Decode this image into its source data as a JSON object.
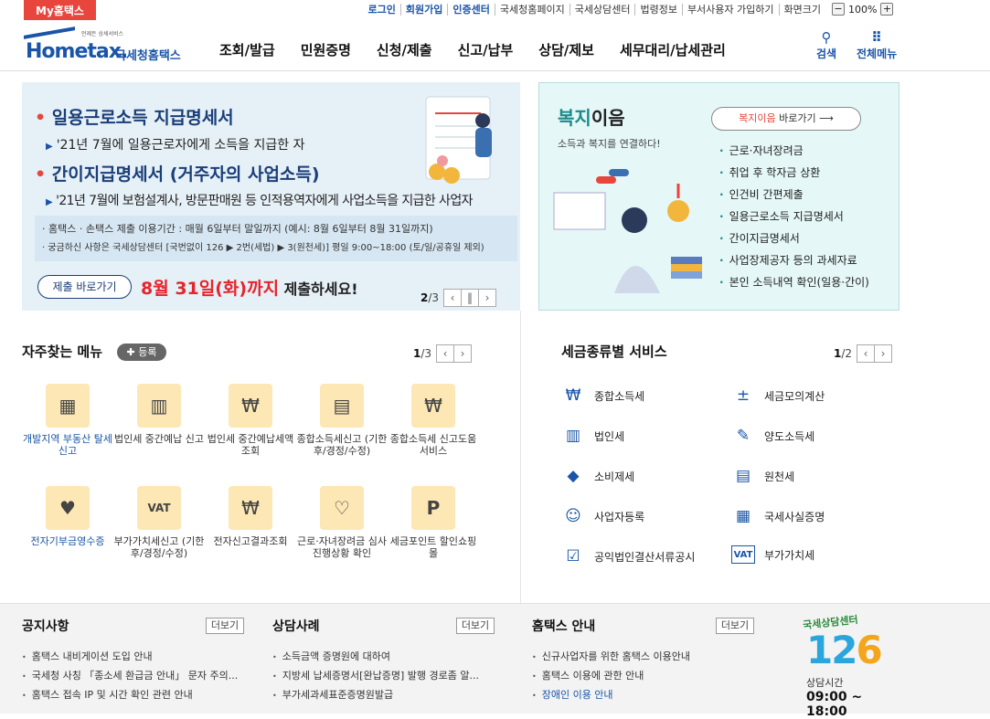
{
  "topbar": {
    "my_hometax": "My홈택스",
    "links": [
      {
        "label": "로그인",
        "bold": true
      },
      {
        "label": "회원가입",
        "bold": true
      },
      {
        "label": "인증센터",
        "bold": true
      },
      {
        "label": "국세청홈페이지",
        "bold": false
      },
      {
        "label": "국세상담센터",
        "bold": false
      },
      {
        "label": "법령정보",
        "bold": false
      },
      {
        "label": "부서사용자 가입하기",
        "bold": false
      },
      {
        "label": "화면크기",
        "bold": false
      }
    ],
    "zoom_minus": "−",
    "zoom_value": "100%",
    "zoom_plus": "+"
  },
  "header": {
    "logo_small": "언제든 상세서비스",
    "logo_home": "Hometax.",
    "logo_kr": "국세청홈택스",
    "nav": [
      "조회/발급",
      "민원증명",
      "신청/제출",
      "신고/납부",
      "상담/제보",
      "세무대리/납세관리"
    ],
    "search_label": "검색",
    "menu_label": "전체메뉴"
  },
  "banner": {
    "line1": "일용근로소득 지급명세서",
    "line1_sub": "'21년 7월에 일용근로자에게 소득을 지급한 자",
    "line2": "간이지급명세서 (거주자의 사업소득)",
    "line2_sub": "'21년 7월에 보험설계사, 방문판매원 등 인적용역자에게 사업소득을 지급한 사업자",
    "note1": "· 홈택스 · 손택스 제출 이용기간 : 매월 6일부터 말일까지 (예시: 8월 6일부터 8월 31일까지)",
    "note2": "· 궁금하신 사항은 국세상담센터 [국번없이 126 ▶ 2번(세법) ▶ 3(원천세)] 평일 9:00~18:00 (토/일/공휴일 제외)",
    "submit_button": "제출 바로가기",
    "deadline": "8월 31일(화)까지",
    "deadline_suffix": " 제출하세요!",
    "page_current": "2",
    "page_total": "/3"
  },
  "welfare": {
    "title_a": "복지",
    "title_b": "이음",
    "subtitle": "소득과 복지를 연결하다!",
    "button_a": "복지이음",
    "button_b": " 바로가기",
    "items": [
      "근로·자녀장려금",
      "취업 후 학자금 상환",
      "인건비 간편제출",
      "일용근로소득 지급명세서",
      "간이지급명세서",
      "사업장제공자 등의 과세자료",
      "본인 소득내역 확인(일용·간이)"
    ]
  },
  "favorites": {
    "title": "자주찾는 메뉴",
    "register": "✚ 등록",
    "page_current": "1",
    "page_total": "/3",
    "items": [
      {
        "label": "개발지역 부동산 탈세신고",
        "icon": "▦",
        "blue": true
      },
      {
        "label": "법인세 중간예납 신고",
        "icon": "▥",
        "blue": false
      },
      {
        "label": "법인세 중간예납세액 조회",
        "icon": "₩",
        "blue": false
      },
      {
        "label": "종합소득세신고 (기한후/경정/수정)",
        "icon": "▤",
        "blue": false
      },
      {
        "label": "종합소득세 신고도움 서비스",
        "icon": "₩",
        "blue": false
      },
      {
        "label": "전자기부금영수증",
        "icon": "♥",
        "blue": true
      },
      {
        "label": "부가가치세신고 (기한후/경정/수정)",
        "icon": "VAT",
        "blue": false
      },
      {
        "label": "전자신고결과조회",
        "icon": "₩",
        "blue": false
      },
      {
        "label": "근로·자녀장려금 심사진행상황 확인",
        "icon": "♡",
        "blue": false
      },
      {
        "label": "세금포인트 할인쇼핑몰",
        "icon": "P",
        "blue": false
      }
    ]
  },
  "taxtypes": {
    "title": "세금종류별 서비스",
    "page_current": "1",
    "page_total": "/2",
    "items": [
      {
        "label": "종합소득세",
        "icon": "₩"
      },
      {
        "label": "세금모의계산",
        "icon": "±"
      },
      {
        "label": "법인세",
        "icon": "▥"
      },
      {
        "label": "양도소득세",
        "icon": "✎"
      },
      {
        "label": "소비제세",
        "icon": "◆"
      },
      {
        "label": "원천세",
        "icon": "▤"
      },
      {
        "label": "사업자등록",
        "icon": "☺"
      },
      {
        "label": "국세사실증명",
        "icon": "▦"
      },
      {
        "label": "공익법인결산서류공시",
        "icon": "☑"
      },
      {
        "label": "부가가치세",
        "icon": "VAT"
      }
    ]
  },
  "bottom": {
    "notice": {
      "title": "공지사항",
      "more": "더보기",
      "items": [
        {
          "text": "홈택스 내비게이션 도입 안내",
          "blue": false
        },
        {
          "text": "국세청 사칭 「종소세 환급금 안내」 문자 주의...",
          "blue": false
        },
        {
          "text": "홈택스 접속 IP 및 시간 확인 관련 안내",
          "blue": false
        }
      ]
    },
    "consult": {
      "title": "상담사례",
      "more": "더보기",
      "items": [
        {
          "text": "소득금액 증명원에 대하여",
          "blue": false
        },
        {
          "text": "지방세 납세증명서[완납증명] 발행 경로좀 알...",
          "blue": false
        },
        {
          "text": "부가세과세표준증명원발급",
          "blue": false
        }
      ]
    },
    "guide": {
      "title": "홈택스 안내",
      "more": "더보기",
      "items": [
        {
          "text": "신규사업자를 위한 홈택스 이용안내",
          "blue": false
        },
        {
          "text": "홈택스 이용에 관한 안내",
          "blue": false
        },
        {
          "text": "장애인 이용 안내",
          "blue": true
        }
      ]
    },
    "center": {
      "heading": "국세상담센터",
      "number_a": "12",
      "number_b": "6",
      "hours_label": "상담시간",
      "hours": "09:00 ~ 18:00"
    }
  }
}
